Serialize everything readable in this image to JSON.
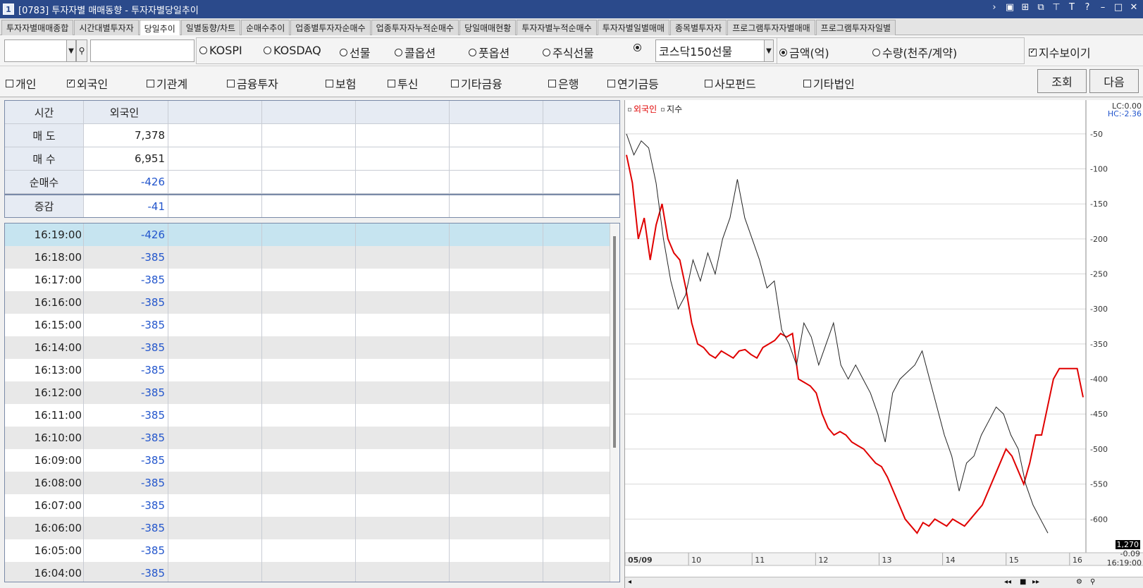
{
  "window": {
    "num": "1",
    "title": "[0783] 투자자별 매매동향 - 투자자별당일추이"
  },
  "tabs": [
    {
      "label": "투자자별매매종합"
    },
    {
      "label": "시간대별투자자"
    },
    {
      "label": "당일추이",
      "active": true
    },
    {
      "label": "일별동향/차트"
    },
    {
      "label": "순매수추이"
    },
    {
      "label": "업종별투자자순매수"
    },
    {
      "label": "업종투자자누적순매수"
    },
    {
      "label": "당일매매현황"
    },
    {
      "label": "투자자별누적순매수"
    },
    {
      "label": "투자자별일별매매"
    },
    {
      "label": "종목별투자자"
    },
    {
      "label": "프로그램투자자별매매"
    },
    {
      "label": "프로그램투자자일별"
    }
  ],
  "market": {
    "options": [
      "KOSPI",
      "KOSDAQ",
      "선물",
      "콜옵션",
      "풋옵션",
      "주식선물"
    ],
    "selected_product": "코스닥150선물",
    "unit_options": [
      "금액(억)",
      "수량(천주/계약)"
    ],
    "selected_unit": "금액(억)",
    "show_index_label": "지수보이기",
    "show_index": true
  },
  "investors": {
    "items": [
      "개인",
      "외국인",
      "기관계",
      "금융투자",
      "보험",
      "투신",
      "기타금융",
      "은행",
      "연기금등",
      "사모펀드",
      "기타법인"
    ],
    "checked": [
      "외국인"
    ]
  },
  "buttons": {
    "query": "조회",
    "next": "다음"
  },
  "summary": {
    "header": [
      "시간",
      "외국인"
    ],
    "rows": [
      {
        "label": "매 도",
        "value": "7,378",
        "neg": false
      },
      {
        "label": "매 수",
        "value": "6,951",
        "neg": false
      },
      {
        "label": "순매수",
        "value": "-426",
        "neg": true
      },
      {
        "label": "증감",
        "value": "-41",
        "neg": true
      }
    ]
  },
  "timeseries": [
    {
      "time": "16:19:00",
      "value": "-426"
    },
    {
      "time": "16:18:00",
      "value": "-385"
    },
    {
      "time": "16:17:00",
      "value": "-385"
    },
    {
      "time": "16:16:00",
      "value": "-385"
    },
    {
      "time": "16:15:00",
      "value": "-385"
    },
    {
      "time": "16:14:00",
      "value": "-385"
    },
    {
      "time": "16:13:00",
      "value": "-385"
    },
    {
      "time": "16:12:00",
      "value": "-385"
    },
    {
      "time": "16:11:00",
      "value": "-385"
    },
    {
      "time": "16:10:00",
      "value": "-385"
    },
    {
      "time": "16:09:00",
      "value": "-385"
    },
    {
      "time": "16:08:00",
      "value": "-385"
    },
    {
      "time": "16:07:00",
      "value": "-385"
    },
    {
      "time": "16:06:00",
      "value": "-385"
    },
    {
      "time": "16:05:00",
      "value": "-385"
    },
    {
      "time": "16:04:00",
      "value": "-385"
    }
  ],
  "chart_data": {
    "type": "line",
    "legend": [
      "외국인",
      "지수"
    ],
    "series_colors": {
      "외국인": "#e00000",
      "지수": "#222222"
    },
    "x_ticks": [
      "05/09",
      "10",
      "11",
      "12",
      "13",
      "14",
      "15",
      "16"
    ],
    "y_ticks": [
      -50,
      -100,
      -150,
      -200,
      -250,
      -300,
      -350,
      -400,
      -450,
      -500,
      -550,
      -600
    ],
    "ylim": [
      -640,
      -30
    ],
    "lc_label": "LC:0.00",
    "hc_label": "HC:-2.36",
    "last_value": "1,270",
    "last_change": "-0.09",
    "time_label": "16:19:00",
    "series": [
      {
        "name": "외국인",
        "values": [
          -80,
          -120,
          -200,
          -170,
          -230,
          -180,
          -150,
          -200,
          -220,
          -230,
          -270,
          -320,
          -350,
          -355,
          -365,
          -370,
          -360,
          -365,
          -370,
          -360,
          -358,
          -365,
          -370,
          -355,
          -350,
          -345,
          -335,
          -340,
          -335,
          -400,
          -405,
          -410,
          -420,
          -450,
          -470,
          -480,
          -475,
          -480,
          -490,
          -495,
          -500,
          -510,
          -520,
          -525,
          -540,
          -560,
          -580,
          -600,
          -610,
          -620,
          -605,
          -610,
          -600,
          -605,
          -610,
          -600,
          -605,
          -610,
          -600,
          -590,
          -580,
          -560,
          -540,
          -520,
          -500,
          -510,
          -530,
          -550,
          -520,
          -480,
          -480,
          -440,
          -400,
          -385,
          -385,
          -385,
          -385,
          -426
        ]
      },
      {
        "name": "지수",
        "values": [
          -50,
          -80,
          -60,
          -70,
          -120,
          -200,
          -260,
          -300,
          -280,
          -230,
          -260,
          -220,
          -250,
          -200,
          -170,
          -115,
          -170,
          -200,
          -230,
          -270,
          -260,
          -330,
          -350,
          -380,
          -320,
          -340,
          -380,
          -350,
          -320,
          -380,
          -400,
          -380,
          -400,
          -420,
          -450,
          -490,
          -420,
          -400,
          -390,
          -380,
          -360,
          -400,
          -440,
          -480,
          -510,
          -560,
          -520,
          -510,
          -480,
          -460,
          -440,
          -450,
          -480,
          -500,
          -550,
          -580,
          -600,
          -620
        ]
      }
    ]
  },
  "chart_toolbar_icons": [
    "scroll-left-icon",
    "first-icon",
    "stop-icon",
    "last-icon",
    "settings-icon",
    "zoom-icon"
  ]
}
